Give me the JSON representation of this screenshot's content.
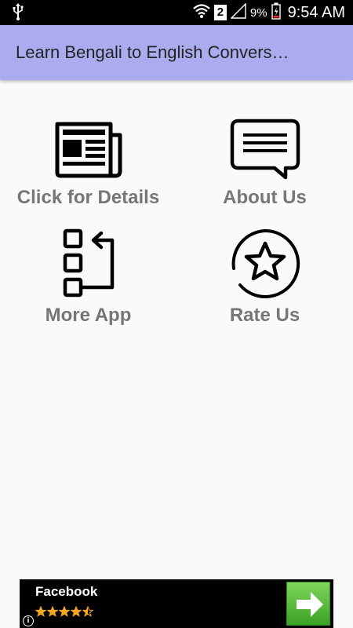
{
  "status_bar": {
    "sim_slot": "2",
    "battery_percent": "9%",
    "time": "9:54 AM",
    "icons": [
      "usb-icon",
      "wifi-icon",
      "signal-icon",
      "battery-icon"
    ]
  },
  "app_bar": {
    "title": "Learn Bengali to English Convers…",
    "background": "#abacf0"
  },
  "tiles": [
    {
      "label": "Click for Details",
      "icon": "newspaper-icon"
    },
    {
      "label": "About Us",
      "icon": "chat-bubble-icon"
    },
    {
      "label": "More App",
      "icon": "app-list-icon"
    },
    {
      "label": "Rate Us",
      "icon": "star-circle-icon"
    }
  ],
  "ad": {
    "title": "Facebook",
    "rating": 4.5,
    "info_glyph": "i",
    "cta_icon": "arrow-right-icon"
  },
  "colors": {
    "label_gray": "#767676",
    "ad_star": "#f5a623",
    "ad_button": "#4cb431"
  }
}
